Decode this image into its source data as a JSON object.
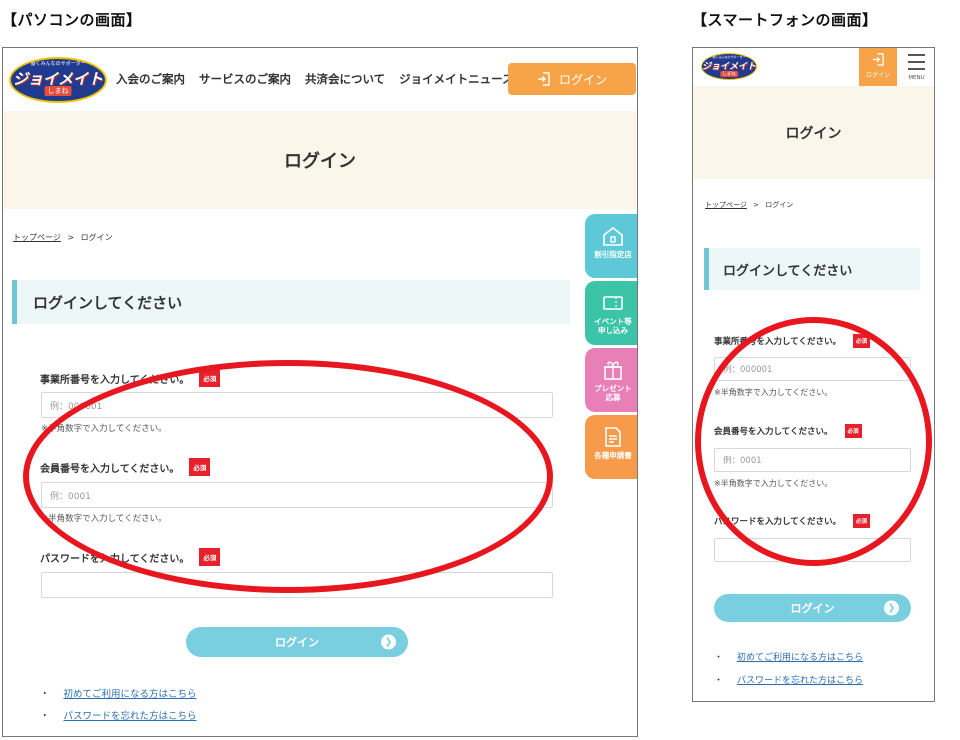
{
  "captions": {
    "pc": "【パソコンの画面】",
    "sp": "【スマートフォンの画面】"
  },
  "logo": {
    "top": "働くみんなのサポーター",
    "main": "ジョイメイト",
    "sub": "しまね"
  },
  "nav": [
    "入会のご案内",
    "サービスのご案内",
    "共済会について",
    "ジョイメイトニュース"
  ],
  "header_login": "ログイン",
  "hero_title": "ログイン",
  "breadcrumb": {
    "home": "トップページ",
    "sep": ">",
    "current": "ログイン"
  },
  "side_tabs": [
    "割引指定店",
    "イベント等\n申し込み",
    "プレゼント\n応募",
    "各種申請書"
  ],
  "login_heading": "ログインしてください",
  "form": {
    "office_label": "事業所番号を入力してください。",
    "office_placeholder": "例：000001",
    "member_label": "会員番号を入力してください。",
    "member_placeholder": "例：0001",
    "password_label": "パスワードを入力してください。",
    "password_placeholder": "",
    "required": "必須",
    "note": "※半角数字で入力してください。",
    "submit": "ログイン"
  },
  "links": {
    "first_time": "初めてご利用になる方はこちら",
    "forgot_password": "パスワードを忘れた方はこちら",
    "bullet": "・"
  },
  "sp": {
    "login_tab": "ログイン",
    "menu": "MENU"
  },
  "colors": {
    "accent_orange": "#f7a348",
    "accent_cyan": "#79cfe0",
    "required_red": "#e6212b",
    "annotation_red": "#e8171f",
    "hero_bg": "#faf6ea"
  }
}
